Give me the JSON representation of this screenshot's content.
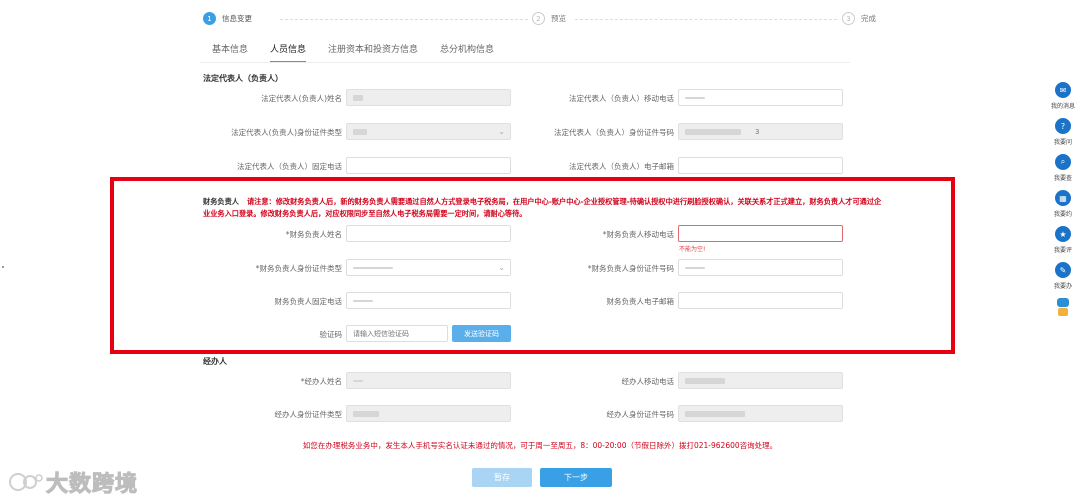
{
  "stepper": {
    "steps": [
      {
        "num": "1",
        "label": "信息变更"
      },
      {
        "num": "2",
        "label": "预览"
      },
      {
        "num": "3",
        "label": "完成"
      }
    ]
  },
  "tabs": [
    "基本信息",
    "人员信息",
    "注册资本和投资方信息",
    "总分机构信息"
  ],
  "legal_rep": {
    "title": "法定代表人（负责人）",
    "name_label": "法定代表人(负责人)姓名",
    "mobile_label": "法定代表人（负责人）移动电话",
    "id_type_label": "法定代表人(负责人)身份证件类型",
    "id_no_label": "法定代表人（负责人）身份证件号码",
    "id_no_suffix": "3",
    "landline_label": "法定代表人（负责人）固定电话",
    "email_label": "法定代表人（负责人）电子邮箱"
  },
  "finance": {
    "title": "财务负责人",
    "notice": "请注意：修改财务负责人后，新的财务负责人需要通过自然人方式登录电子税务局，在用户中心-账户中心-企业授权管理-待确认授权中进行刷脸授权确认，关联关系才正式建立，财务负责人才可通过企业业务入口登录。修改财务负责人后，对应权限同步至自然人电子税务局需要一定时间，请耐心等待。",
    "name_label": "*财务负责人姓名",
    "mobile_label": "*财务负责人移动电话",
    "mobile_error": "不能为空!",
    "id_type_label": "*财务负责人身份证件类型",
    "id_no_label": "*财务负责人身份证件号码",
    "landline_label": "财务负责人固定电话",
    "email_label": "财务负责人电子邮箱",
    "code_label": "验证码",
    "code_placeholder": "请输入短信验证码",
    "code_button": "发送验证码"
  },
  "agent": {
    "title": "经办人",
    "name_label": "*经办人姓名",
    "mobile_label": "经办人移动电话",
    "id_type_label": "经办人身份证件类型",
    "id_no_label": "经办人身份证件号码"
  },
  "footer_note": "如您在办理税务业务中，发生本人手机号实名认证未通过的情况，可于周一至周五，8：00-20:00（节假日除外）拨打021-962600咨询处理。",
  "buttons": {
    "save": "暂存",
    "next": "下一步"
  },
  "sidebar": [
    {
      "label": "我的消息",
      "icon": "message-icon",
      "glyph": "✉"
    },
    {
      "label": "我要问",
      "icon": "question-icon",
      "glyph": "?"
    },
    {
      "label": "我要查",
      "icon": "search-icon",
      "glyph": "⌕"
    },
    {
      "label": "我要约",
      "icon": "calendar-icon",
      "glyph": "▦"
    },
    {
      "label": "我要评",
      "icon": "review-icon",
      "glyph": "★"
    },
    {
      "label": "我要办",
      "icon": "edit-icon",
      "glyph": "✎"
    }
  ],
  "watermark": {
    "text": "大数跨境"
  },
  "colors": {
    "accent": "#3aa0e6",
    "highlight_border": "#e60012",
    "notice_text": "#d0021b"
  }
}
